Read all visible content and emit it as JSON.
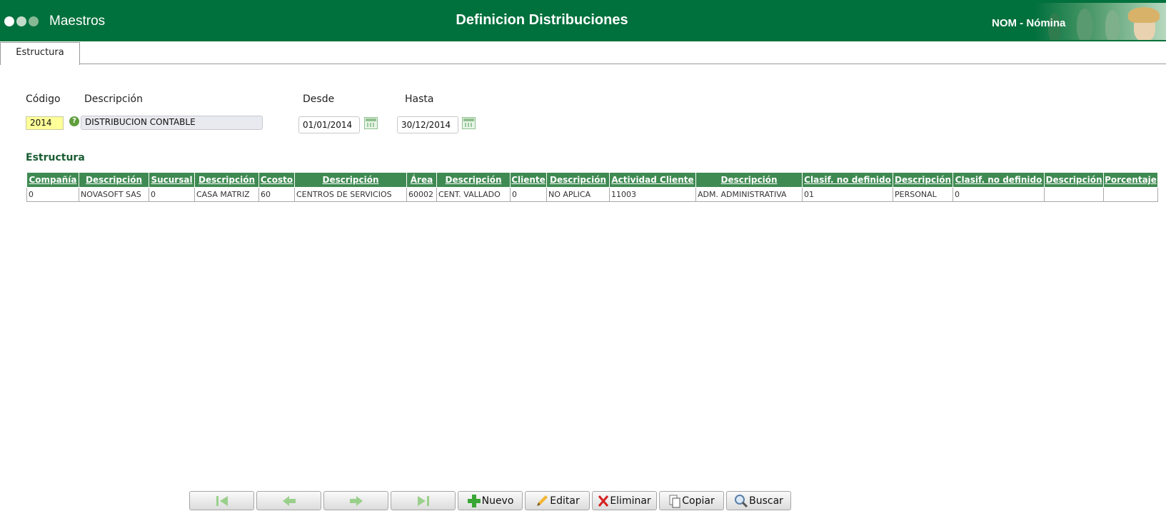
{
  "header": {
    "app_name": "Maestros",
    "page_title": "Definicion Distribuciones",
    "module": "NOM - Nómina",
    "colors": {
      "bar": "#00703c",
      "dot1": "#ffffff",
      "dot2": "#c3dcc9",
      "dot3": "#86b894"
    }
  },
  "tabs": [
    {
      "label": "Estructura",
      "active": true
    }
  ],
  "form": {
    "codigo_label": "Código",
    "descripcion_label": "Descripción",
    "desde_label": "Desde",
    "hasta_label": "Hasta",
    "codigo_value": "2014",
    "descripcion_value": "DISTRIBUCION CONTABLE",
    "desde_value": "01/01/2014",
    "hasta_value": "30/12/2014"
  },
  "estructura": {
    "title": "Estructura",
    "columns": [
      "Compañía",
      "Descripción",
      "Sucursal",
      "Descripción",
      "Ccosto",
      "Descripción",
      "Área",
      "Descripción",
      "Cliente",
      "Descripción",
      "Actividad Cliente",
      "Descripción",
      "Clasif. no definido",
      "Descripción",
      "Clasif. no definido",
      "Descripción",
      "Porcentaje"
    ],
    "rows": [
      [
        "0",
        "NOVASOFT SAS",
        "0",
        "CASA MATRIZ",
        "60",
        "CENTROS DE SERVICIOS",
        "60002",
        "CENT. VALLADO",
        "0",
        "NO APLICA",
        "11003",
        "ADM. ADMINISTRATIVA",
        "01",
        "PERSONAL",
        "0",
        "",
        ""
      ]
    ]
  },
  "toolbar": {
    "nuevo": "Nuevo",
    "editar": "Editar",
    "eliminar": "Eliminar",
    "copiar": "Copiar",
    "buscar": "Buscar",
    "nav_icons": [
      "first-record-icon",
      "previous-record-icon",
      "next-record-icon",
      "last-record-icon"
    ]
  }
}
